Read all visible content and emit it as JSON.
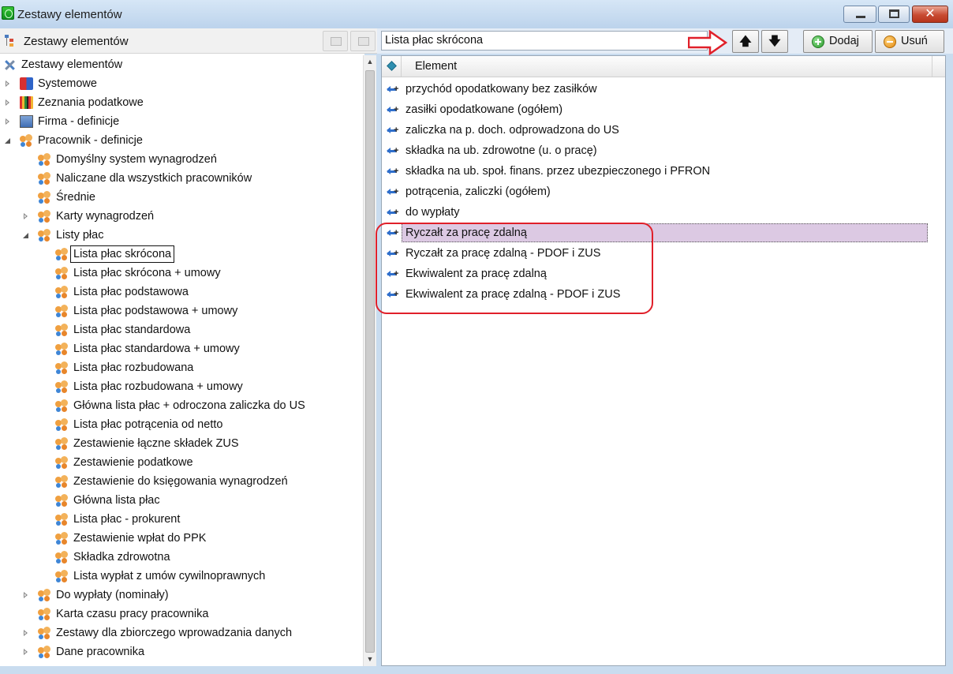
{
  "window": {
    "title": "Zestawy elementów"
  },
  "left_panel": {
    "header": "Zestawy elementów",
    "tree": [
      {
        "label": "Zestawy elementów",
        "level": 0,
        "icon": "tools-icon",
        "expander": "none"
      },
      {
        "label": "Systemowe",
        "level": 1,
        "icon": "system-icon",
        "expander": "closed"
      },
      {
        "label": "Zeznania podatkowe",
        "level": 1,
        "icon": "tax-icon",
        "expander": "closed"
      },
      {
        "label": "Firma - definicje",
        "level": 1,
        "icon": "company-icon",
        "expander": "closed"
      },
      {
        "label": "Pracownik - definicje",
        "level": 1,
        "icon": "people-icon",
        "expander": "open"
      },
      {
        "label": "Domyślny system wynagrodzeń",
        "level": 2,
        "icon": "people-icon",
        "expander": "none"
      },
      {
        "label": "Naliczane dla wszystkich pracowników",
        "level": 2,
        "icon": "people-icon",
        "expander": "none"
      },
      {
        "label": "Średnie",
        "level": 2,
        "icon": "people-icon",
        "expander": "none"
      },
      {
        "label": "Karty wynagrodzeń",
        "level": 2,
        "icon": "people-icon",
        "expander": "closed"
      },
      {
        "label": "Listy płac",
        "level": 2,
        "icon": "people-icon",
        "expander": "open"
      },
      {
        "label": "Lista płac skrócona",
        "level": 3,
        "icon": "people-icon",
        "expander": "none",
        "selected": true
      },
      {
        "label": "Lista płac skrócona + umowy",
        "level": 3,
        "icon": "people-icon",
        "expander": "none"
      },
      {
        "label": "Lista płac podstawowa",
        "level": 3,
        "icon": "people-icon",
        "expander": "none"
      },
      {
        "label": "Lista płac podstawowa + umowy",
        "level": 3,
        "icon": "people-icon",
        "expander": "none"
      },
      {
        "label": "Lista płac standardowa",
        "level": 3,
        "icon": "people-icon",
        "expander": "none"
      },
      {
        "label": "Lista płac standardowa + umowy",
        "level": 3,
        "icon": "people-icon",
        "expander": "none"
      },
      {
        "label": "Lista płac rozbudowana",
        "level": 3,
        "icon": "people-icon",
        "expander": "none"
      },
      {
        "label": "Lista płac rozbudowana + umowy",
        "level": 3,
        "icon": "people-icon",
        "expander": "none"
      },
      {
        "label": "Główna lista płac + odroczona zaliczka do US",
        "level": 3,
        "icon": "people-icon",
        "expander": "none"
      },
      {
        "label": "Lista płac potrącenia od netto",
        "level": 3,
        "icon": "people-icon",
        "expander": "none"
      },
      {
        "label": "Zestawienie łączne składek ZUS",
        "level": 3,
        "icon": "people-icon",
        "expander": "none"
      },
      {
        "label": "Zestawienie podatkowe",
        "level": 3,
        "icon": "people-icon",
        "expander": "none"
      },
      {
        "label": "Zestawienie do księgowania wynagrodzeń",
        "level": 3,
        "icon": "people-icon",
        "expander": "none"
      },
      {
        "label": "Główna lista płac",
        "level": 3,
        "icon": "people-icon",
        "expander": "none"
      },
      {
        "label": "Lista płac - prokurent",
        "level": 3,
        "icon": "people-icon",
        "expander": "none"
      },
      {
        "label": "Zestawienie wpłat do PPK",
        "level": 3,
        "icon": "people-icon",
        "expander": "none"
      },
      {
        "label": "Składka zdrowotna",
        "level": 3,
        "icon": "people-icon",
        "expander": "none"
      },
      {
        "label": "Lista wypłat z umów cywilnoprawnych",
        "level": 3,
        "icon": "people-icon",
        "expander": "none"
      },
      {
        "label": "Do wypłaty (nominały)",
        "level": 2,
        "icon": "people-icon",
        "expander": "closed"
      },
      {
        "label": "Karta czasu pracy pracownika",
        "level": 2,
        "icon": "people-icon",
        "expander": "none"
      },
      {
        "label": "Zestawy dla zbiorczego wprowadzania danych",
        "level": 2,
        "icon": "people-icon",
        "expander": "closed"
      },
      {
        "label": "Dane pracownika",
        "level": 2,
        "icon": "people-icon",
        "expander": "closed"
      }
    ]
  },
  "right_panel": {
    "set_name": "Lista płac skrócona",
    "buttons": {
      "up": "🡅",
      "down": "🡇",
      "add": "Dodaj",
      "remove": "Usuń"
    },
    "grid_header": "Element",
    "elements": [
      {
        "label": "przychód opodatkowany bez zasiłków"
      },
      {
        "label": "zasiłki opodatkowane (ogółem)"
      },
      {
        "label": "zaliczka na p. doch. odprowadzona do US"
      },
      {
        "label": "składka na ub. zdrowotne (u. o pracę)"
      },
      {
        "label": "składka na ub. społ. finans. przez ubezpieczonego i PFRON"
      },
      {
        "label": "potrącenia, zaliczki (ogółem)"
      },
      {
        "label": "do wypłaty"
      },
      {
        "label": "Ryczałt za pracę zdalną",
        "selected": true
      },
      {
        "label": "Ryczałt za pracę zdalną - PDOF i ZUS"
      },
      {
        "label": "Ekwiwalent za pracę zdalną"
      },
      {
        "label": "Ekwiwalent za pracę zdalną - PDOF i ZUS"
      }
    ]
  },
  "colors": {
    "selection": "#dcc9e3",
    "highlight_border": "#e0202a",
    "accent": "#2f6fcc"
  }
}
